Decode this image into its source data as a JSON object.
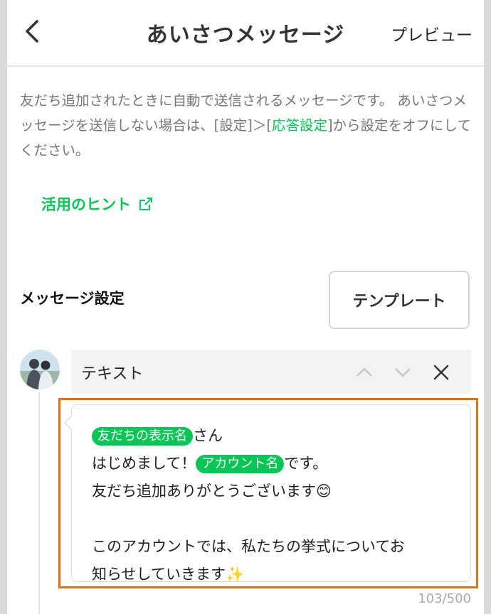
{
  "header": {
    "title": "あいさつメッセージ",
    "preview_label": "プレビュー"
  },
  "description": {
    "part1": "友だち追加されたときに自動で送信されるメッセージです。 あいさつメッセージを送信しない場合は、[設定]＞[",
    "link": "応答設定",
    "part2": "]から設定をオフにしてください。"
  },
  "hint": {
    "label": "活用のヒント",
    "icon": "external-link-icon"
  },
  "message_settings": {
    "label": "メッセージ設定",
    "template_button": "テンプレート"
  },
  "message": {
    "type_label": "テキスト",
    "icons": [
      "chevron-up-icon",
      "chevron-down-icon",
      "close-icon"
    ],
    "line1_tag": "友だちの表示名",
    "line1_text": "さん",
    "line2_pre": "はじめまして！",
    "line2_tag": "アカウント名",
    "line2_post": "です。",
    "line3": "友だち追加ありがとうございます😊",
    "line4": "",
    "line5": "このアカウントでは、私たちの挙式についてお",
    "line6": "知らせしていきます✨",
    "char_count": "103/500"
  },
  "colors": {
    "accent": "#06c755",
    "highlight_frame": "#e8700f",
    "background": "#ffffff"
  }
}
